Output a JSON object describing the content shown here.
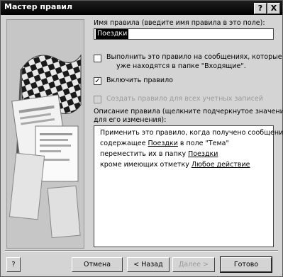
{
  "window": {
    "title": "Мастер правил",
    "help_glyph": "?",
    "close_glyph": "X"
  },
  "form": {
    "name_label": "Имя правила (введите имя правила в это поле):",
    "name_value": "Поездки",
    "run_now_line1": "Выполнить это правило на сообщениях, которые",
    "run_now_line2": "уже находятся в папке \"Входящие\".",
    "run_now_checked": false,
    "enable_label": "Включить правило",
    "enable_checked": true,
    "all_accounts_label": "Создать правило для всех учетных записей",
    "all_accounts_checked": false,
    "desc_label_line1": "Описание правила (щелкните подчеркнутое значение",
    "desc_label_line2": "для его изменения):"
  },
  "description": {
    "line1": "Применить это правило, когда получено сообщение",
    "line2_prefix": "содержащее ",
    "line2_link": "Поездки",
    "line2_suffix": " в поле \"Тема\"",
    "line3_prefix": "переместить их в папку ",
    "line3_link": "Поездки",
    "line4_prefix": "кроме имеющих отметку ",
    "line4_link": "Любое действие"
  },
  "footer": {
    "help_glyph": "?",
    "cancel_label": "Отмена",
    "back_label": "< Назад",
    "next_label": "Далее >",
    "finish_label": "Готово"
  }
}
